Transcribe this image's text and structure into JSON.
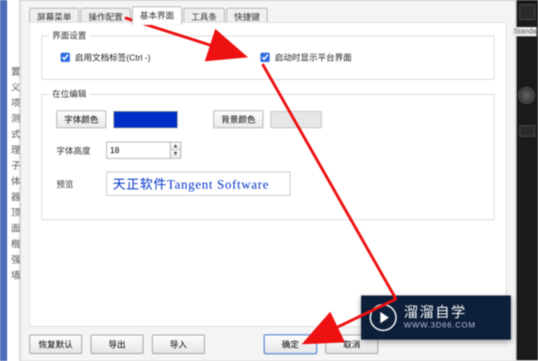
{
  "tabs": {
    "t0": "屏幕菜单",
    "t1": "操作配置",
    "t2": "基本界面",
    "t3": "工具条",
    "t4": "快捷键"
  },
  "group1": {
    "title": "界面设置",
    "chk1_label": "启用文档标签(Ctrl -)",
    "chk2_label": "启动时显示平台界面"
  },
  "group2": {
    "title": "在位编辑",
    "font_color_btn": "字体颜色",
    "bg_color_btn": "背景颜色",
    "font_height_label": "字体高度",
    "font_height_value": "18",
    "preview_label": "预览",
    "preview_text": "天正软件Tangent Software"
  },
  "buttons": {
    "restore": "恢复默认",
    "export": "导出",
    "import": "导入",
    "ok": "确定",
    "cancel": "取消"
  },
  "right_panel": {
    "standard": "Standa"
  },
  "watermark": {
    "title": "溜溜自学",
    "url": "WWW.3D66.COM"
  },
  "colors": {
    "font_swatch": "#0030c8",
    "bg_swatch": "#e6e6e6"
  },
  "left_strip_chars": [
    "置",
    "义",
    "项",
    "测",
    "式",
    "理",
    "子",
    "体",
    "器",
    "顶",
    "面",
    "楷",
    "强",
    "墙"
  ]
}
